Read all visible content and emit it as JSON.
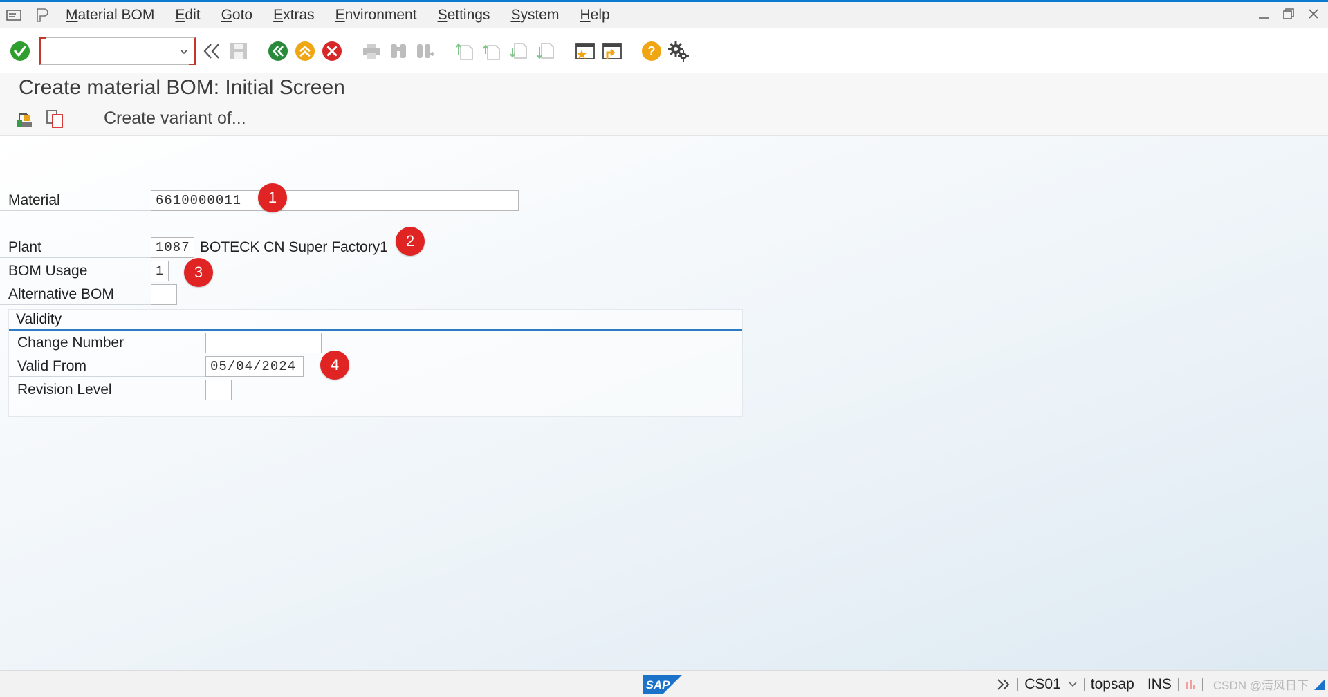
{
  "menubar": {
    "items": [
      "Material BOM",
      "Edit",
      "Goto",
      "Extras",
      "Environment",
      "Settings",
      "System",
      "Help"
    ]
  },
  "window_controls": [
    "minimize-icon",
    "restore-icon",
    "close-icon"
  ],
  "toolbar": {
    "command_field_value": "",
    "icons": [
      "enter-check-icon",
      "double-chevron-left-icon",
      "save-icon",
      "back-icon",
      "exit-icon",
      "cancel-icon",
      "print-icon",
      "find-icon",
      "find-next-icon",
      "first-page-icon",
      "previous-page-icon",
      "next-page-icon",
      "last-page-icon",
      "create-session-icon",
      "shortcut-icon",
      "help-icon",
      "customize-layout-gear-icon"
    ]
  },
  "title": "Create material BOM: Initial Screen",
  "app_toolbar": {
    "create_variant_label": "Create variant of..."
  },
  "form": {
    "material_label": "Material",
    "material_value": "6610000011",
    "plant_label": "Plant",
    "plant_value": "1087",
    "plant_desc": "BOTECK CN Super Factory1",
    "bom_usage_label": "BOM Usage",
    "bom_usage_value": "1",
    "alt_bom_label": "Alternative BOM",
    "alt_bom_value": ""
  },
  "validity": {
    "title": "Validity",
    "change_number_label": "Change Number",
    "change_number_value": "",
    "valid_from_label": "Valid From",
    "valid_from_value": "05/04/2024",
    "revision_level_label": "Revision Level",
    "revision_level_value": ""
  },
  "badges": [
    "1",
    "2",
    "3",
    "4"
  ],
  "statusbar": {
    "logo": "SAP",
    "transaction": "CS01",
    "system": "topsap",
    "mode": "INS",
    "watermark": "CSDN @清风日下"
  },
  "colors": {
    "accent": "#0a7bd1",
    "badge": "#e02424",
    "enter_green": "#2e9e2e",
    "back_green": "#2a8a3c",
    "exit_orange": "#f0a513",
    "cancel_red": "#d62828",
    "help_yellow": "#f0a513"
  }
}
